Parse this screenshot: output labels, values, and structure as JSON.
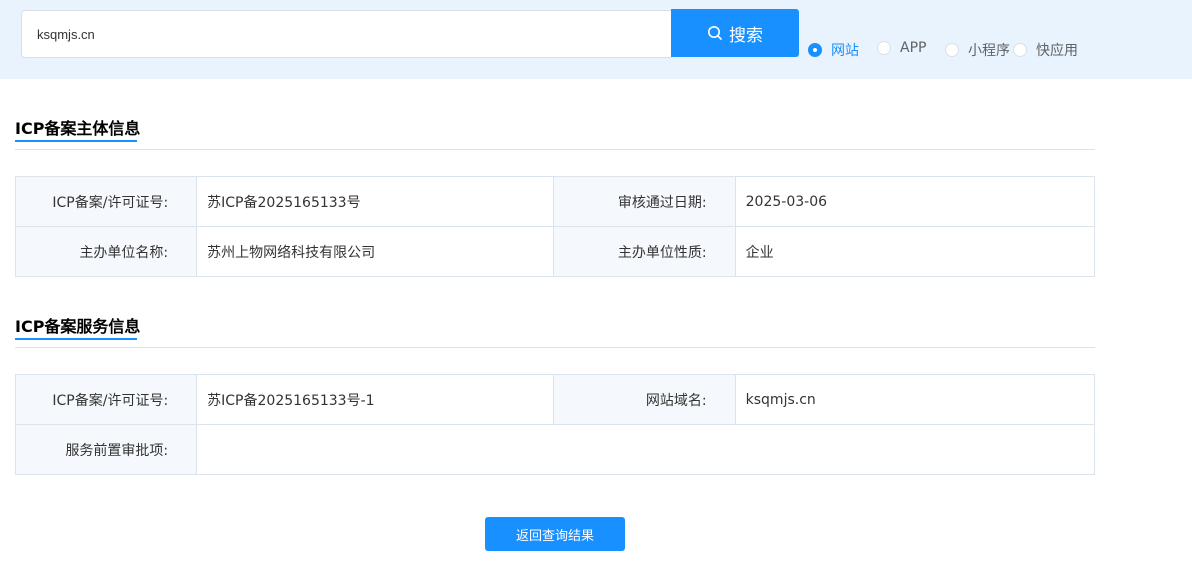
{
  "search": {
    "value": "ksqmjs.cn",
    "button_label": "搜索"
  },
  "radios": [
    {
      "label": "网站",
      "checked": true
    },
    {
      "label": "APP",
      "checked": false
    },
    {
      "label": "小程序",
      "checked": false
    },
    {
      "label": "快应用",
      "checked": false
    }
  ],
  "subject": {
    "title": "ICP备案主体信息",
    "rows": [
      {
        "label1": "ICP备案/许可证号:",
        "value1": "苏ICP备2025165133号",
        "label2": "审核通过日期:",
        "value2": "2025-03-06"
      },
      {
        "label1": "主办单位名称:",
        "value1": "苏州上物网络科技有限公司",
        "label2": "主办单位性质:",
        "value2": "企业"
      }
    ]
  },
  "service": {
    "title": "ICP备案服务信息",
    "license_label": "ICP备案/许可证号:",
    "license_value": "苏ICP备2025165133号-1",
    "domain_label": "网站域名:",
    "domain_value": "ksqmjs.cn",
    "approval_label": "服务前置审批项:",
    "approval_value": ""
  },
  "back_button_label": "返回查询结果",
  "colors": {
    "accent": "#1890ff",
    "topbar_bg": "#e8f3fd",
    "label_bg": "#f5f9fd"
  }
}
